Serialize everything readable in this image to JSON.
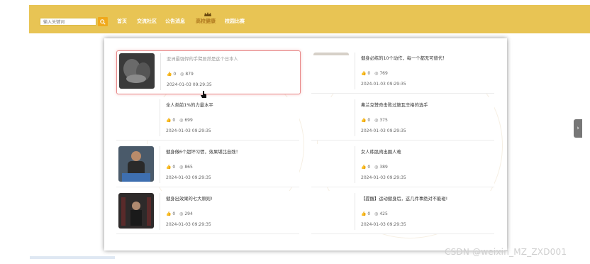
{
  "search": {
    "placeholder": "输入关键词"
  },
  "nav": [
    {
      "label": "首页"
    },
    {
      "label": "交流社区"
    },
    {
      "label": "公告消息"
    },
    {
      "label": "高校健康"
    },
    {
      "label": "校园比赛"
    }
  ],
  "articles": [
    {
      "title": "亚洲最强悍的手臂居然是这个日本人",
      "likes": "0",
      "views": "879",
      "date": "2024-01-03 09:29:35"
    },
    {
      "title": "健身必练的10个动作，每一个都无可替代！",
      "likes": "0",
      "views": "769",
      "date": "2024-01-03 09:29:35"
    },
    {
      "title": "全人类前1%的力量水平",
      "likes": "0",
      "views": "699",
      "date": "2024-01-03 09:29:35"
    },
    {
      "title": "弗兰克赞奇击败过施瓦辛格的选手",
      "likes": "0",
      "views": "375",
      "date": "2024-01-03 09:29:35"
    },
    {
      "title": "健身做6个超坏习惯，效果堪比自残！",
      "likes": "0",
      "views": "865",
      "date": "2024-01-03 09:29:35"
    },
    {
      "title": "女人练肌肉出圈人难",
      "likes": "0",
      "views": "389",
      "date": "2024-01-03 09:29:35"
    },
    {
      "title": "健身出效果的七大原则!",
      "likes": "0",
      "views": "294",
      "date": "2024-01-03 09:29:35"
    },
    {
      "title": "【提醒】运动健身后，这几件事绝对不能碰!",
      "likes": "0",
      "views": "425",
      "date": "2024-01-03 09:29:35"
    }
  ],
  "watermark": "CSDN @weixin_MZ_ZXD001",
  "colors": {
    "topbar": "#e8c454",
    "search_button": "#f0a91c",
    "highlight_border": "#e88a8a"
  }
}
